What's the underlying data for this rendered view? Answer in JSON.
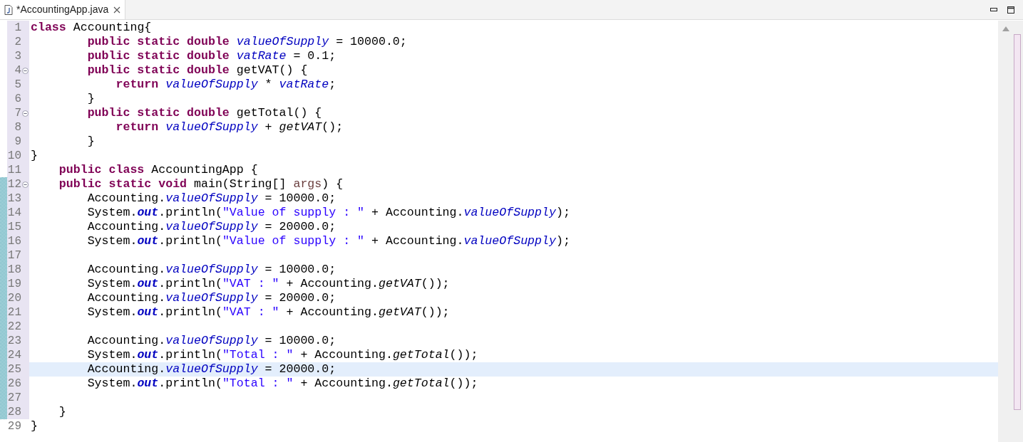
{
  "tab": {
    "title": "*AccountingApp.java",
    "selected": true
  },
  "lines": [
    {
      "number": "1",
      "marked": true,
      "changed": false,
      "current": false,
      "tokens": [
        {
          "kind": "keyword",
          "text": "class"
        },
        {
          "kind": "plain",
          "text": " Accounting{"
        }
      ]
    },
    {
      "number": "2",
      "marked": true,
      "changed": false,
      "current": false,
      "tokens": [
        {
          "kind": "keyword",
          "text": "        public static double "
        },
        {
          "kind": "field",
          "text": "valueOfSupply"
        },
        {
          "kind": "plain",
          "text": " = 10000.0;"
        }
      ]
    },
    {
      "number": "3",
      "marked": true,
      "changed": false,
      "current": false,
      "tokens": [
        {
          "kind": "keyword",
          "text": "        public static double "
        },
        {
          "kind": "field",
          "text": "vatRate"
        },
        {
          "kind": "plain",
          "text": " = 0.1;"
        }
      ]
    },
    {
      "number": "4",
      "marked": true,
      "changed": false,
      "current": false,
      "fold": {
        "expanded": true
      },
      "tokens": [
        {
          "kind": "keyword",
          "text": "        public static double"
        },
        {
          "kind": "plain",
          "text": " getVAT() {"
        }
      ]
    },
    {
      "number": "5",
      "marked": true,
      "changed": false,
      "current": false,
      "tokens": [
        {
          "kind": "keyword",
          "text": "            return "
        },
        {
          "kind": "field",
          "text": "valueOfSupply"
        },
        {
          "kind": "plain",
          "text": " * "
        },
        {
          "kind": "field",
          "text": "vatRate"
        },
        {
          "kind": "plain",
          "text": ";"
        }
      ]
    },
    {
      "number": "6",
      "marked": true,
      "changed": false,
      "current": false,
      "tokens": [
        {
          "kind": "plain",
          "text": "        }"
        }
      ]
    },
    {
      "number": "7",
      "marked": true,
      "changed": false,
      "current": false,
      "fold": {
        "expanded": true
      },
      "tokens": [
        {
          "kind": "keyword",
          "text": "        public static double"
        },
        {
          "kind": "plain",
          "text": " getTotal() {"
        }
      ]
    },
    {
      "number": "8",
      "marked": true,
      "changed": false,
      "current": false,
      "tokens": [
        {
          "kind": "keyword",
          "text": "            return "
        },
        {
          "kind": "field",
          "text": "valueOfSupply"
        },
        {
          "kind": "plain",
          "text": " + "
        },
        {
          "kind": "static_method",
          "text": "getVAT"
        },
        {
          "kind": "plain",
          "text": "();"
        }
      ]
    },
    {
      "number": "9",
      "marked": true,
      "changed": false,
      "current": false,
      "tokens": [
        {
          "kind": "plain",
          "text": "        }"
        }
      ]
    },
    {
      "number": "10",
      "marked": true,
      "changed": false,
      "current": false,
      "tokens": [
        {
          "kind": "plain",
          "text": "}"
        }
      ]
    },
    {
      "number": "11",
      "marked": true,
      "changed": false,
      "current": false,
      "tokens": [
        {
          "kind": "keyword",
          "text": "    public class"
        },
        {
          "kind": "plain",
          "text": " AccountingApp {"
        }
      ]
    },
    {
      "number": "12",
      "marked": true,
      "changed": true,
      "current": false,
      "fold": {
        "expanded": true
      },
      "tokens": [
        {
          "kind": "keyword",
          "text": "    public static void"
        },
        {
          "kind": "plain",
          "text": " main(String[] "
        },
        {
          "kind": "parameter",
          "text": "args"
        },
        {
          "kind": "plain",
          "text": ") {"
        }
      ]
    },
    {
      "number": "13",
      "marked": true,
      "changed": true,
      "current": false,
      "tokens": [
        {
          "kind": "plain",
          "text": "        Accounting."
        },
        {
          "kind": "field",
          "text": "valueOfSupply"
        },
        {
          "kind": "plain",
          "text": " = 10000.0;"
        }
      ]
    },
    {
      "number": "14",
      "marked": true,
      "changed": true,
      "current": false,
      "tokens": [
        {
          "kind": "plain",
          "text": "        System."
        },
        {
          "kind": "static_field",
          "text": "out"
        },
        {
          "kind": "plain",
          "text": ".println("
        },
        {
          "kind": "string",
          "text": "\"Value of supply : \""
        },
        {
          "kind": "plain",
          "text": " + Accounting."
        },
        {
          "kind": "field",
          "text": "valueOfSupply"
        },
        {
          "kind": "plain",
          "text": ");"
        }
      ]
    },
    {
      "number": "15",
      "marked": true,
      "changed": true,
      "current": false,
      "tokens": [
        {
          "kind": "plain",
          "text": "        Accounting."
        },
        {
          "kind": "field",
          "text": "valueOfSupply"
        },
        {
          "kind": "plain",
          "text": " = 20000.0;"
        }
      ]
    },
    {
      "number": "16",
      "marked": true,
      "changed": true,
      "current": false,
      "tokens": [
        {
          "kind": "plain",
          "text": "        System."
        },
        {
          "kind": "static_field",
          "text": "out"
        },
        {
          "kind": "plain",
          "text": ".println("
        },
        {
          "kind": "string",
          "text": "\"Value of supply : \""
        },
        {
          "kind": "plain",
          "text": " + Accounting."
        },
        {
          "kind": "field",
          "text": "valueOfSupply"
        },
        {
          "kind": "plain",
          "text": ");"
        }
      ]
    },
    {
      "number": "17",
      "marked": true,
      "changed": true,
      "current": false
    },
    {
      "number": "18",
      "marked": true,
      "changed": true,
      "current": false,
      "tokens": [
        {
          "kind": "plain",
          "text": "        Accounting."
        },
        {
          "kind": "field",
          "text": "valueOfSupply"
        },
        {
          "kind": "plain",
          "text": " = 10000.0;"
        }
      ]
    },
    {
      "number": "19",
      "marked": true,
      "changed": true,
      "current": false,
      "tokens": [
        {
          "kind": "plain",
          "text": "        System."
        },
        {
          "kind": "static_field",
          "text": "out"
        },
        {
          "kind": "plain",
          "text": ".println("
        },
        {
          "kind": "string",
          "text": "\"VAT : \""
        },
        {
          "kind": "plain",
          "text": " + Accounting."
        },
        {
          "kind": "static_method",
          "text": "getVAT"
        },
        {
          "kind": "plain",
          "text": "());"
        }
      ]
    },
    {
      "number": "20",
      "marked": true,
      "changed": true,
      "current": false,
      "tokens": [
        {
          "kind": "plain",
          "text": "        Accounting."
        },
        {
          "kind": "field",
          "text": "valueOfSupply"
        },
        {
          "kind": "plain",
          "text": " = 20000.0;"
        }
      ]
    },
    {
      "number": "21",
      "marked": true,
      "changed": true,
      "current": false,
      "tokens": [
        {
          "kind": "plain",
          "text": "        System."
        },
        {
          "kind": "static_field",
          "text": "out"
        },
        {
          "kind": "plain",
          "text": ".println("
        },
        {
          "kind": "string",
          "text": "\"VAT : \""
        },
        {
          "kind": "plain",
          "text": " + Accounting."
        },
        {
          "kind": "static_method",
          "text": "getVAT"
        },
        {
          "kind": "plain",
          "text": "());"
        }
      ]
    },
    {
      "number": "22",
      "marked": true,
      "changed": true,
      "current": false
    },
    {
      "number": "23",
      "marked": true,
      "changed": true,
      "current": false,
      "tokens": [
        {
          "kind": "plain",
          "text": "        Accounting."
        },
        {
          "kind": "field",
          "text": "valueOfSupply"
        },
        {
          "kind": "plain",
          "text": " = 10000.0;"
        }
      ]
    },
    {
      "number": "24",
      "marked": true,
      "changed": true,
      "current": false,
      "tokens": [
        {
          "kind": "plain",
          "text": "        System."
        },
        {
          "kind": "static_field",
          "text": "out"
        },
        {
          "kind": "plain",
          "text": ".println("
        },
        {
          "kind": "string",
          "text": "\"Total : \""
        },
        {
          "kind": "plain",
          "text": " + Accounting."
        },
        {
          "kind": "static_method",
          "text": "getTotal"
        },
        {
          "kind": "plain",
          "text": "());"
        }
      ]
    },
    {
      "number": "25",
      "marked": true,
      "changed": true,
      "current": true,
      "tokens": [
        {
          "kind": "plain",
          "text": "        Accounting."
        },
        {
          "kind": "field",
          "text": "valueOfSupply"
        },
        {
          "kind": "plain",
          "text": " = 20000.0;"
        }
      ]
    },
    {
      "number": "26",
      "marked": true,
      "changed": true,
      "current": false,
      "tokens": [
        {
          "kind": "plain",
          "text": "        System."
        },
        {
          "kind": "static_field",
          "text": "out"
        },
        {
          "kind": "plain",
          "text": ".println("
        },
        {
          "kind": "string",
          "text": "\"Total : \""
        },
        {
          "kind": "plain",
          "text": " + Accounting."
        },
        {
          "kind": "static_method",
          "text": "getTotal"
        },
        {
          "kind": "plain",
          "text": "());"
        }
      ]
    },
    {
      "number": "27",
      "marked": true,
      "changed": true,
      "current": false
    },
    {
      "number": "28",
      "marked": true,
      "changed": true,
      "current": false,
      "tokens": [
        {
          "kind": "plain",
          "text": "    }"
        }
      ]
    },
    {
      "number": "29",
      "marked": false,
      "changed": false,
      "current": false,
      "tokens": [
        {
          "kind": "plain",
          "text": "}"
        }
      ]
    }
  ]
}
